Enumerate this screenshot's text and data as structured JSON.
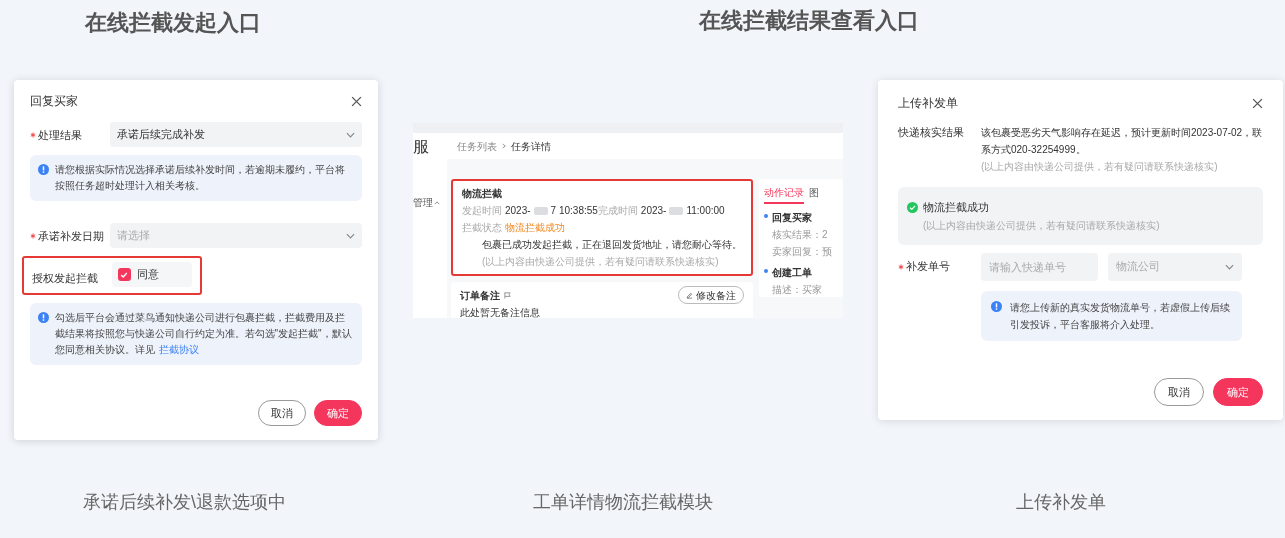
{
  "headings": [
    "在线拦截发起入口",
    "在线拦截结果查看入口"
  ],
  "reply_dialog": {
    "title": "回复买家",
    "result": {
      "label": "处理结果",
      "required": true,
      "value": "承诺后续完成补发"
    },
    "result_notice": "请您根据实际情况选择承诺后续补发时间，若逾期未履约，平台将按照任务超时处理计入相关考核。",
    "date": {
      "label": "承诺补发日期",
      "required": true,
      "placeholder": "请选择"
    },
    "authorize": {
      "label": "授权发起拦截",
      "option": "同意",
      "checked": true,
      "highlighted": true
    },
    "authorize_notice": {
      "text": "勾选后平台会通过菜鸟通知快递公司进行包裹拦截，拦截费用及拦截结果将按照您与快递公司自行约定为准。若勾选\"发起拦截\"，默认您同意相关协议。详见",
      "link": "拦截协议"
    },
    "buttons": [
      {
        "label": "取消",
        "kind": "secondary"
      },
      {
        "label": "确定",
        "kind": "primary"
      }
    ]
  },
  "task_detail": {
    "sidebar_title": "服",
    "nav_item": "管理",
    "breadcrumb": [
      "任务列表",
      "任务详情"
    ],
    "card": {
      "title": "物流拦截",
      "highlighted": true,
      "start_label": "发起时间",
      "start_prefix": "2023-",
      "start_suffix": "7 10:38:55",
      "end_label": "完成时间",
      "end_prefix": "2023-",
      "end_suffix": "11:00:00",
      "status_label": "拦截状态",
      "status": "物流拦截成功",
      "message": "包裹已成功发起拦截，正在退回发货地址，请您耐心等待。",
      "note": "(以上内容由快递公司提供，若有疑问请联系快递核实)"
    },
    "remark": {
      "title": "订单备注",
      "button": "修改备注",
      "text": "此处暂无备注信息"
    },
    "tabs": [
      {
        "label": "动作记录",
        "selected": true
      },
      {
        "label": "图",
        "selected": false
      }
    ],
    "timeline": [
      {
        "title": "回复买家",
        "lines": [
          "核实结果：2",
          "卖家回复：预"
        ]
      },
      {
        "title": "创建工单",
        "lines": [
          "描述：买家"
        ]
      }
    ]
  },
  "upload_dialog": {
    "title": "上传补发单",
    "verify_label": "快递核实结果",
    "verify_text": "该包裹受恶劣天气影响存在延迟，预计更新时间2023-07-02，联系方式020-32254999。",
    "verify_note": "(以上内容由快递公司提供，若有疑问请联系快递核实)",
    "result": {
      "title": "物流拦截成功",
      "note": "(以上内容由快递公司提供，若有疑问请联系快递核实)"
    },
    "reissue": {
      "label": "补发单号",
      "required": true,
      "tracking_placeholder": "请输入快递单号",
      "company_placeholder": "物流公司"
    },
    "notice": "请您上传新的真实发货物流单号，若虚假上传后续引发投诉，平台客服将介入处理。",
    "buttons": [
      {
        "label": "取消",
        "kind": "secondary"
      },
      {
        "label": "确定",
        "kind": "primary"
      }
    ]
  },
  "captions": [
    "承诺后续补发\\退款选项中",
    "工单详情物流拦截模块",
    "上传补发单"
  ]
}
